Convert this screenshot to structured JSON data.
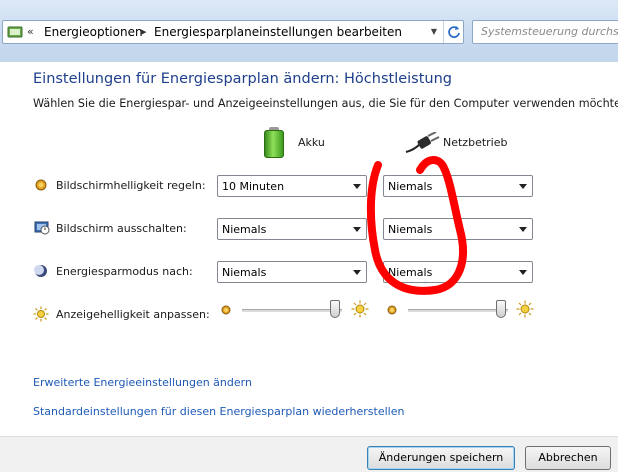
{
  "addressbar": {
    "nav_marker": "«",
    "crumbs": [
      "Energieoptionen",
      "Energiesparplaneinstellungen bearbeiten"
    ],
    "separator": "▸",
    "search_placeholder": "Systemsteuerung durchsuc"
  },
  "page": {
    "title": "Einstellungen für Energiesparplan ändern: Höchstleistung",
    "subtitle": "Wählen Sie die Energiespar- und Anzeigeeinstellungen aus, die Sie für den Computer verwenden möchten."
  },
  "columns": {
    "battery": "Akku",
    "plugged_in": "Netzbetrieb"
  },
  "settings": [
    {
      "label": "Bildschirmhelligkeit regeln:",
      "battery": "10 Minuten",
      "plugged_in": "Niemals",
      "icon": "brightness-dim-icon"
    },
    {
      "label": "Bildschirm ausschalten:",
      "battery": "Niemals",
      "plugged_in": "Niemals",
      "icon": "monitor-clock-icon"
    },
    {
      "label": "Energiesparmodus nach:",
      "battery": "Niemals",
      "plugged_in": "Niemals",
      "icon": "moon-icon"
    }
  ],
  "brightness": {
    "label": "Anzeigehelligkeit anpassen:",
    "battery_level": 1.0,
    "plugged_in_level": 1.0
  },
  "links": {
    "advanced": "Erweiterte Energieeinstellungen ändern",
    "restore": "Standardeinstellungen für diesen Energiesparplan wiederherstellen"
  },
  "buttons": {
    "save": "Änderungen speichern",
    "cancel": "Abbrechen"
  },
  "colors": {
    "title": "#1e3f8a",
    "link": "#1e5ab5",
    "annotation": "#ff0000"
  }
}
